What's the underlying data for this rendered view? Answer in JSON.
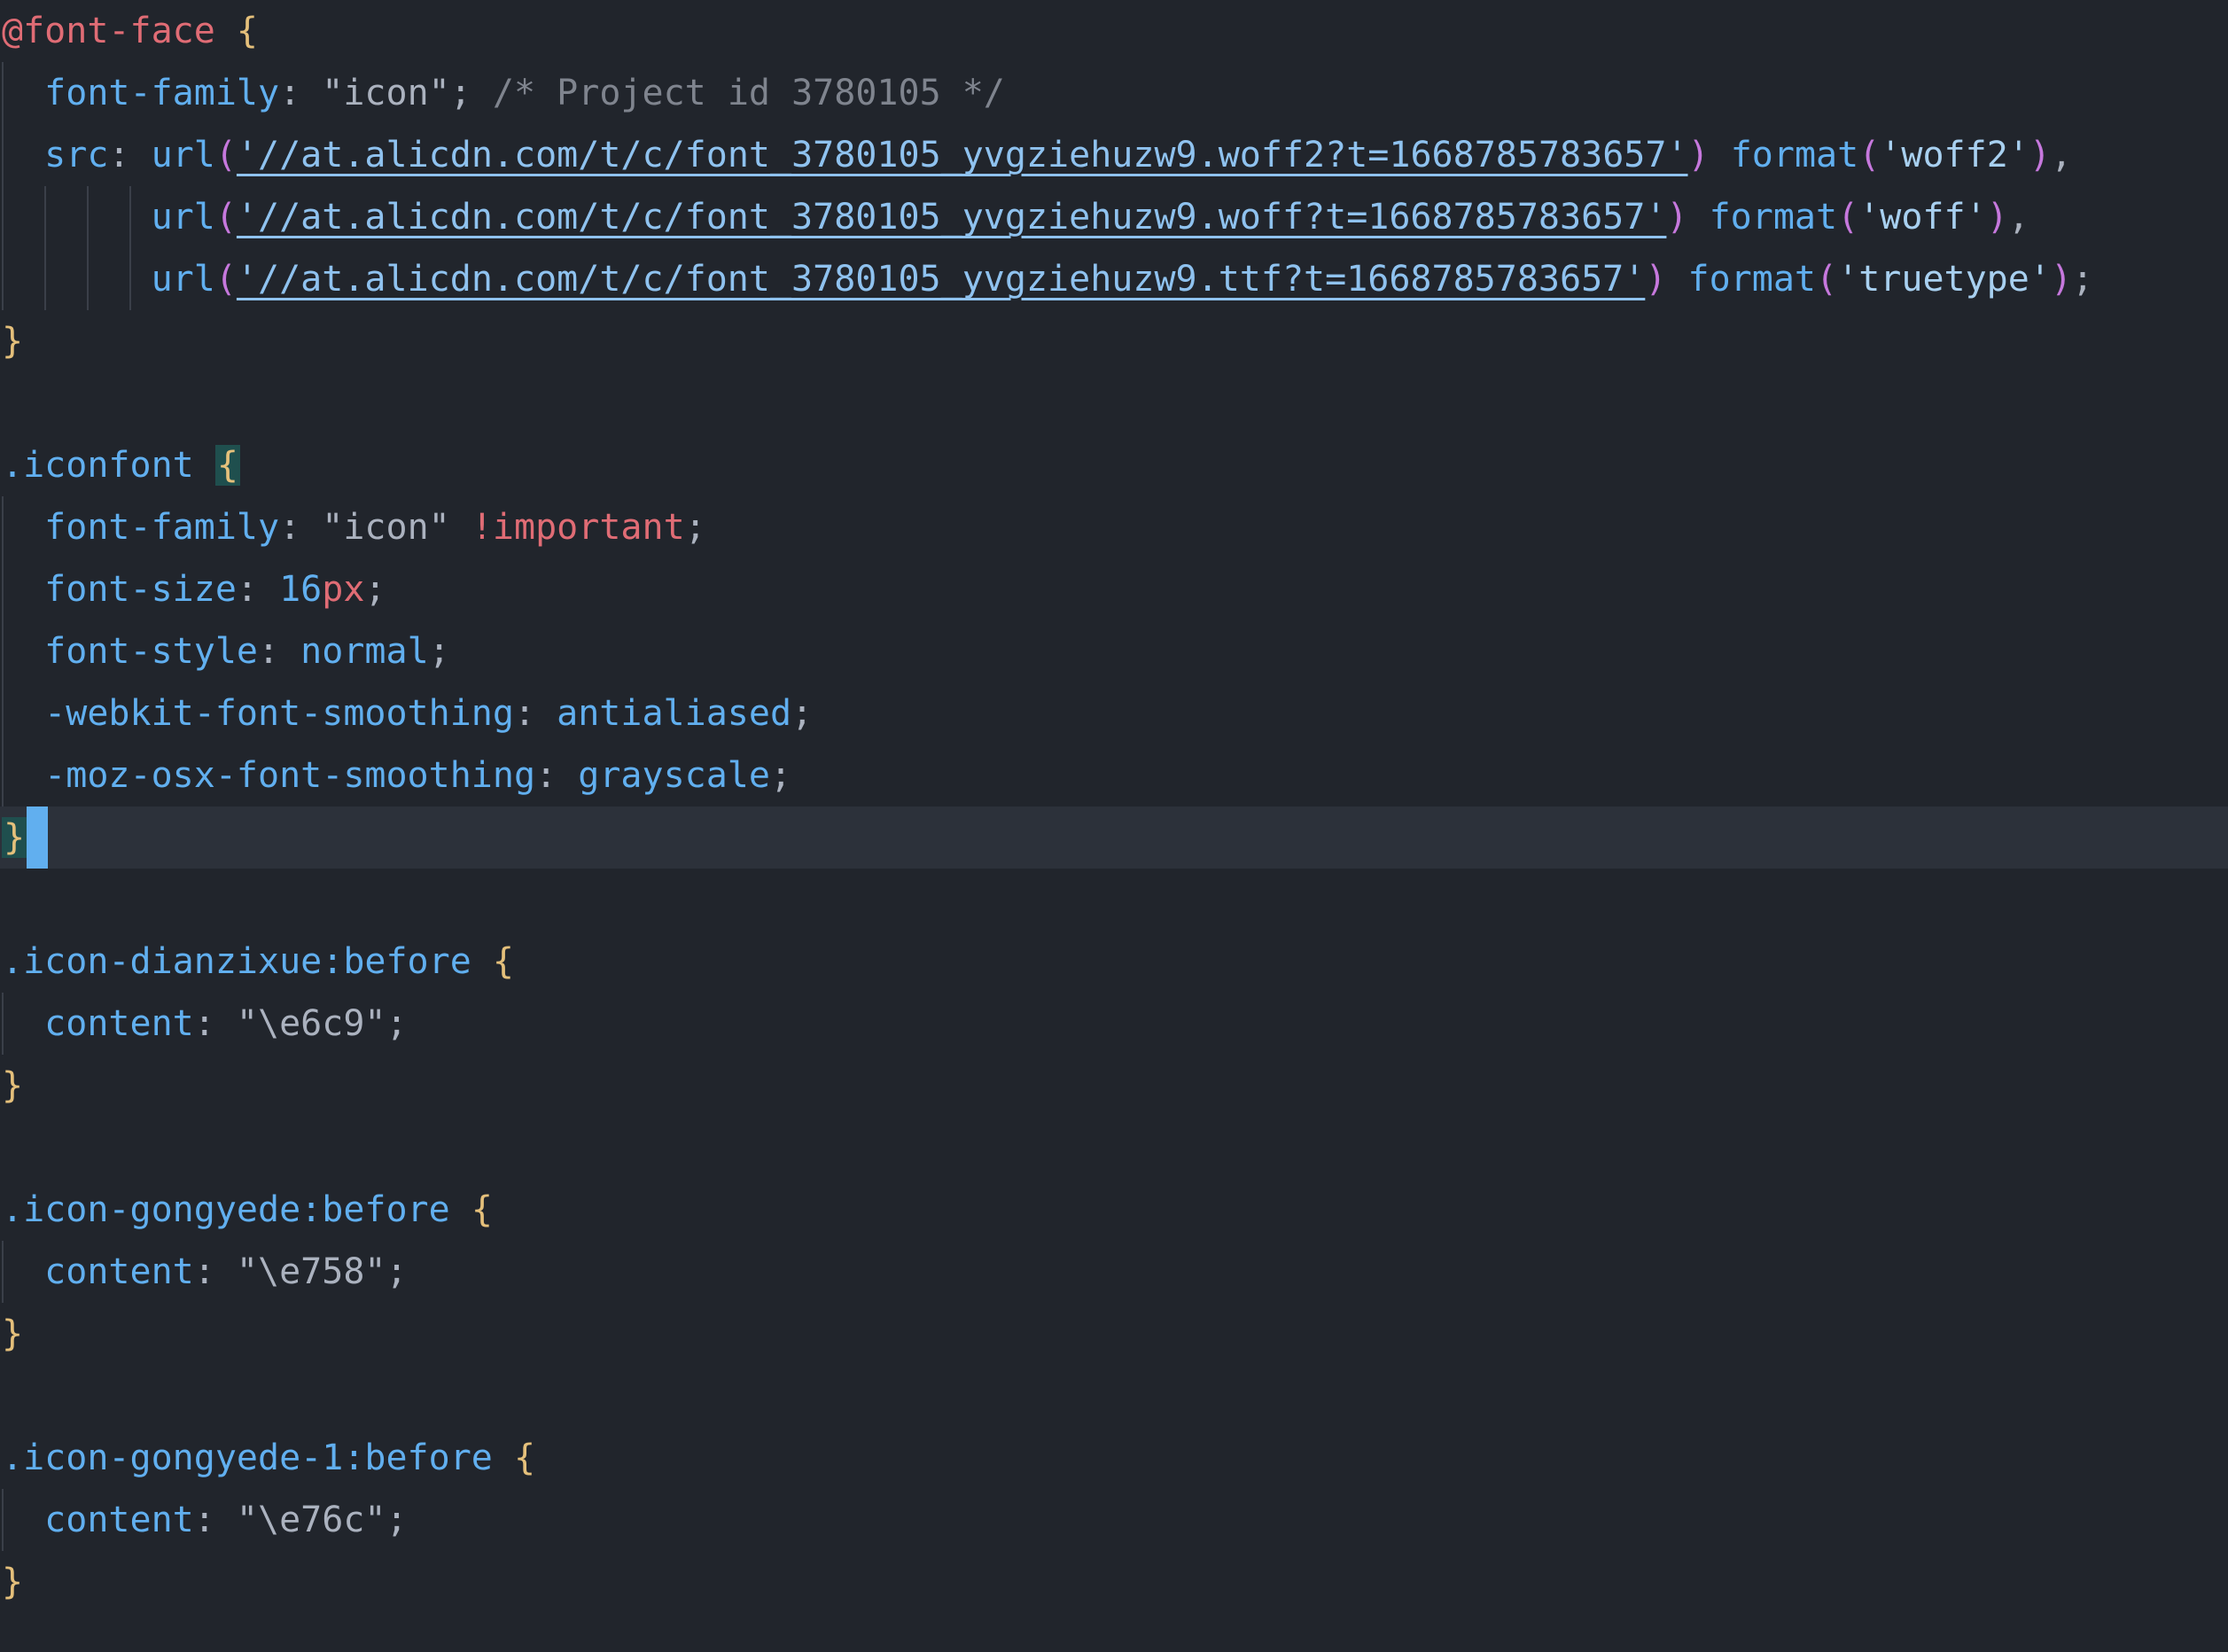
{
  "editor": {
    "lines": [
      [
        {
          "t": "@font-face",
          "c": "at"
        },
        {
          "t": " ",
          "c": "plain"
        },
        {
          "t": "{",
          "c": "brace"
        }
      ],
      [
        {
          "t": "  font-family",
          "c": "prop"
        },
        {
          "t": ": ",
          "c": "plain"
        },
        {
          "t": "\"icon\"",
          "c": "plain"
        },
        {
          "t": "; ",
          "c": "plain"
        },
        {
          "t": "/* Project id 3780105 */",
          "c": "comment"
        }
      ],
      [
        {
          "t": "  src",
          "c": "prop"
        },
        {
          "t": ": ",
          "c": "plain"
        },
        {
          "t": "url",
          "c": "func"
        },
        {
          "t": "(",
          "c": "paren"
        },
        {
          "t": "'//at.alicdn.com/t/c/font_3780105_yvgziehuzw9.woff2?t=1668785783657'",
          "c": "url"
        },
        {
          "t": ")",
          "c": "paren"
        },
        {
          "t": " format",
          "c": "func"
        },
        {
          "t": "(",
          "c": "paren"
        },
        {
          "t": "'woff2'",
          "c": "string"
        },
        {
          "t": ")",
          "c": "paren"
        },
        {
          "t": ",",
          "c": "plain"
        }
      ],
      [
        {
          "t": "       url",
          "c": "func"
        },
        {
          "t": "(",
          "c": "paren"
        },
        {
          "t": "'//at.alicdn.com/t/c/font_3780105_yvgziehuzw9.woff?t=1668785783657'",
          "c": "url"
        },
        {
          "t": ")",
          "c": "paren"
        },
        {
          "t": " format",
          "c": "func"
        },
        {
          "t": "(",
          "c": "paren"
        },
        {
          "t": "'woff'",
          "c": "string"
        },
        {
          "t": ")",
          "c": "paren"
        },
        {
          "t": ",",
          "c": "plain"
        }
      ],
      [
        {
          "t": "       url",
          "c": "func"
        },
        {
          "t": "(",
          "c": "paren"
        },
        {
          "t": "'//at.alicdn.com/t/c/font_3780105_yvgziehuzw9.ttf?t=1668785783657'",
          "c": "url"
        },
        {
          "t": ")",
          "c": "paren"
        },
        {
          "t": " format",
          "c": "func"
        },
        {
          "t": "(",
          "c": "paren"
        },
        {
          "t": "'truetype'",
          "c": "string"
        },
        {
          "t": ")",
          "c": "paren"
        },
        {
          "t": ";",
          "c": "plain"
        }
      ],
      [
        {
          "t": "}",
          "c": "brace"
        }
      ],
      [],
      [
        {
          "t": ".iconfont",
          "c": "selector"
        },
        {
          "t": " ",
          "c": "plain"
        },
        {
          "t": "{",
          "c": "brace-match"
        }
      ],
      [
        {
          "t": "  font-family",
          "c": "prop"
        },
        {
          "t": ": ",
          "c": "plain"
        },
        {
          "t": "\"icon\"",
          "c": "plain"
        },
        {
          "t": " ",
          "c": "plain"
        },
        {
          "t": "!important",
          "c": "important"
        },
        {
          "t": ";",
          "c": "plain"
        }
      ],
      [
        {
          "t": "  font-size",
          "c": "prop"
        },
        {
          "t": ": ",
          "c": "plain"
        },
        {
          "t": "16",
          "c": "number"
        },
        {
          "t": "px",
          "c": "unit"
        },
        {
          "t": ";",
          "c": "plain"
        }
      ],
      [
        {
          "t": "  font-style",
          "c": "prop"
        },
        {
          "t": ": ",
          "c": "plain"
        },
        {
          "t": "normal",
          "c": "value"
        },
        {
          "t": ";",
          "c": "plain"
        }
      ],
      [
        {
          "t": "  -webkit-font-smoothing",
          "c": "prop"
        },
        {
          "t": ": ",
          "c": "plain"
        },
        {
          "t": "antialiased",
          "c": "value"
        },
        {
          "t": ";",
          "c": "plain"
        }
      ],
      [
        {
          "t": "  -moz-osx-font-smoothing",
          "c": "prop"
        },
        {
          "t": ": ",
          "c": "plain"
        },
        {
          "t": "grayscale",
          "c": "value"
        },
        {
          "t": ";",
          "c": "plain"
        }
      ],
      [
        {
          "t": "}",
          "c": "brace-match"
        },
        {
          "t": "",
          "c": "cursor"
        }
      ],
      [],
      [
        {
          "t": ".icon-dianzixue:before",
          "c": "selector"
        },
        {
          "t": " ",
          "c": "plain"
        },
        {
          "t": "{",
          "c": "brace"
        }
      ],
      [
        {
          "t": "  content",
          "c": "prop"
        },
        {
          "t": ": ",
          "c": "plain"
        },
        {
          "t": "\"\\e6c9\"",
          "c": "plain"
        },
        {
          "t": ";",
          "c": "plain"
        }
      ],
      [
        {
          "t": "}",
          "c": "brace"
        }
      ],
      [],
      [
        {
          "t": ".icon-gongyede:before",
          "c": "selector"
        },
        {
          "t": " ",
          "c": "plain"
        },
        {
          "t": "{",
          "c": "brace"
        }
      ],
      [
        {
          "t": "  content",
          "c": "prop"
        },
        {
          "t": ": ",
          "c": "plain"
        },
        {
          "t": "\"\\e758\"",
          "c": "plain"
        },
        {
          "t": ";",
          "c": "plain"
        }
      ],
      [
        {
          "t": "}",
          "c": "brace"
        }
      ],
      [],
      [
        {
          "t": ".icon-gongyede-1:before",
          "c": "selector"
        },
        {
          "t": " ",
          "c": "plain"
        },
        {
          "t": "{",
          "c": "brace"
        }
      ],
      [
        {
          "t": "  content",
          "c": "prop"
        },
        {
          "t": ": ",
          "c": "plain"
        },
        {
          "t": "\"\\e76c\"",
          "c": "plain"
        },
        {
          "t": ";",
          "c": "plain"
        }
      ],
      [
        {
          "t": "}",
          "c": "brace"
        }
      ]
    ],
    "current_line_index": 13
  },
  "colors": {
    "background": "#21252c",
    "current_line": "#2c313a",
    "cursor": "#61afef"
  }
}
